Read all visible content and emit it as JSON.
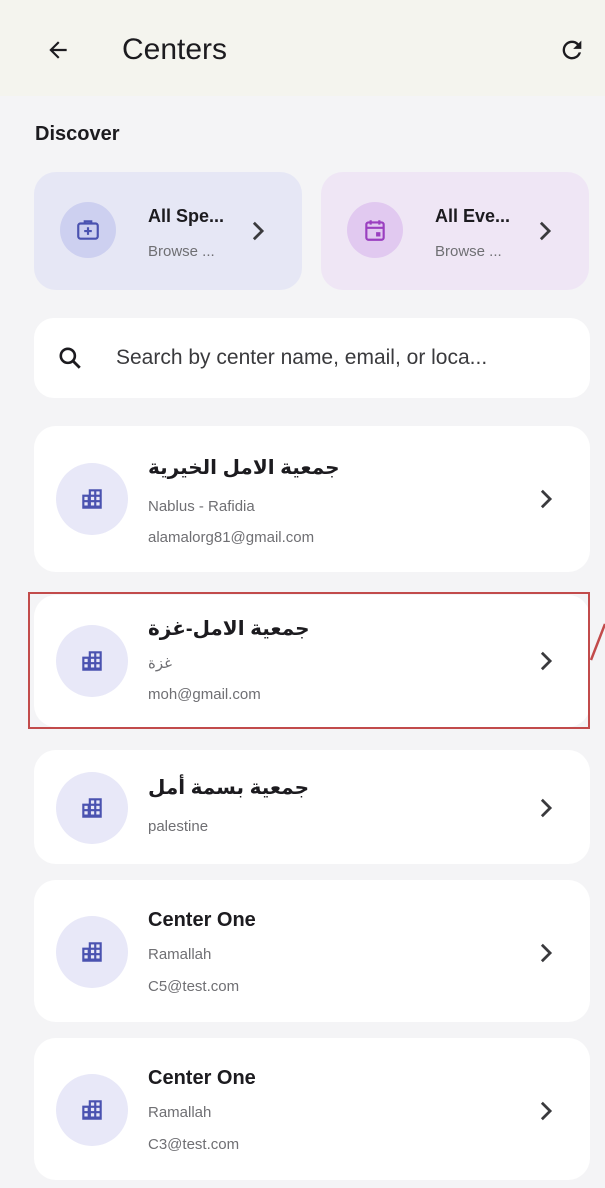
{
  "appbar": {
    "title": "Centers",
    "back_icon": "arrow-left-icon",
    "refresh_icon": "refresh-icon"
  },
  "discover": {
    "title": "Discover",
    "cards": [
      {
        "title": "All Spe...",
        "subtitle": "Browse ...",
        "icon": "medical-kit-icon"
      },
      {
        "title": "All Eve...",
        "subtitle": "Browse ...",
        "icon": "calendar-icon"
      }
    ]
  },
  "search": {
    "placeholder": "Search by center name, email, or loca..."
  },
  "centers": [
    {
      "name": "جمعية الامل الخيرية",
      "location": "Nablus - Rafidia",
      "email": "alamalorg81@gmail.com"
    },
    {
      "name": "جمعية الامل-غزة",
      "location": "غزة",
      "email": "moh@gmail.com"
    },
    {
      "name": "جمعية بسمة أمل",
      "location": "palestine",
      "email": ""
    },
    {
      "name": "Center One",
      "location": "Ramallah",
      "email": "C5@test.com"
    },
    {
      "name": "Center One",
      "location": "Ramallah",
      "email": "C3@test.com"
    }
  ],
  "colors": {
    "accent": "#5c64c8",
    "highlight": "#c24b4b"
  }
}
